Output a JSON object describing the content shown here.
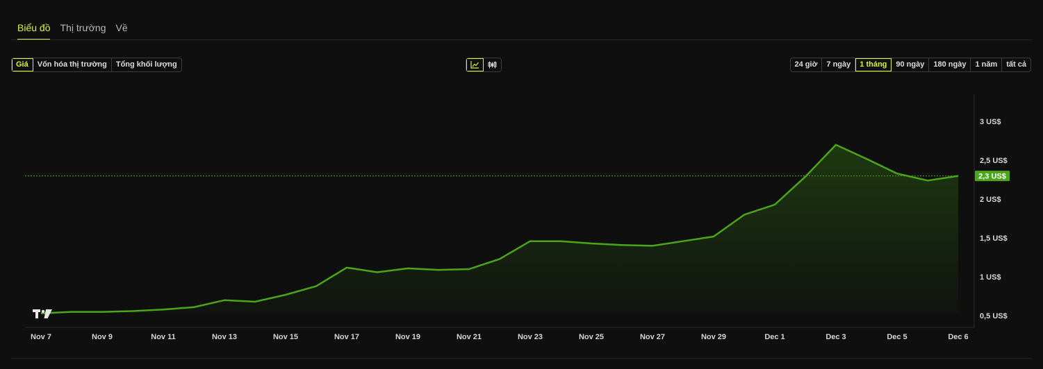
{
  "tabs": [
    {
      "label": "Biểu đồ",
      "active": true
    },
    {
      "label": "Thị trường",
      "active": false
    },
    {
      "label": "Về",
      "active": false
    }
  ],
  "metric_toggle": [
    {
      "label": "Giá",
      "active": true
    },
    {
      "label": "Vốn hóa thị trường",
      "active": false
    },
    {
      "label": "Tổng khối lượng",
      "active": false
    }
  ],
  "chart_style_toggle": [
    {
      "icon": "line-chart-icon",
      "active": true
    },
    {
      "icon": "candlestick-icon",
      "active": false
    }
  ],
  "range_toggle": [
    {
      "label": "24 giờ",
      "active": false
    },
    {
      "label": "7 ngày",
      "active": false
    },
    {
      "label": "1 tháng",
      "active": true
    },
    {
      "label": "90 ngày",
      "active": false
    },
    {
      "label": "180 ngày",
      "active": false
    },
    {
      "label": "1 năm",
      "active": false
    },
    {
      "label": "tất cả",
      "active": false
    }
  ],
  "colors": {
    "accent": "#d7f53b",
    "line": "#4ca61a",
    "price_badge": "#4ca61a"
  },
  "chart_data": {
    "type": "area",
    "title": "",
    "xlabel": "",
    "ylabel": "",
    "x_tick_labels": [
      "Nov 7",
      "Nov 9",
      "Nov 11",
      "Nov 13",
      "Nov 15",
      "Nov 17",
      "Nov 19",
      "Nov 21",
      "Nov 23",
      "Nov 25",
      "Nov 27",
      "Nov 29",
      "Dec 1",
      "Dec 3",
      "Dec 5",
      "Dec 6"
    ],
    "y_tick_labels": [
      "3 US$",
      "2,5 US$",
      "2 US$",
      "1,5 US$",
      "1 US$",
      "0,5 US$"
    ],
    "y_ticks": [
      3.0,
      2.5,
      2.0,
      1.5,
      1.0,
      0.5
    ],
    "ylim": [
      0.35,
      3.35
    ],
    "current_price": 2.3,
    "current_price_label": "2,3 US$",
    "series": [
      {
        "x": [
          "Nov 7",
          "Nov 8",
          "Nov 9",
          "Nov 10",
          "Nov 11",
          "Nov 12",
          "Nov 13",
          "Nov 14",
          "Nov 15",
          "Nov 16",
          "Nov 17",
          "Nov 18",
          "Nov 19",
          "Nov 20",
          "Nov 21",
          "Nov 22",
          "Nov 23",
          "Nov 24",
          "Nov 25",
          "Nov 26",
          "Nov 27",
          "Nov 28",
          "Nov 29",
          "Nov 30",
          "Dec 1",
          "Dec 2",
          "Dec 3",
          "Dec 4",
          "Dec 5",
          "Dec 6",
          "Dec 6 (now)"
        ],
        "values": [
          0.53,
          0.55,
          0.55,
          0.56,
          0.58,
          0.61,
          0.7,
          0.68,
          0.77,
          0.88,
          1.12,
          1.06,
          1.11,
          1.09,
          1.1,
          1.23,
          1.46,
          1.46,
          1.43,
          1.41,
          1.4,
          1.46,
          1.52,
          1.8,
          1.93,
          2.29,
          2.7,
          2.52,
          2.33,
          2.24,
          2.3
        ]
      }
    ],
    "grid": false,
    "legend": "none"
  }
}
